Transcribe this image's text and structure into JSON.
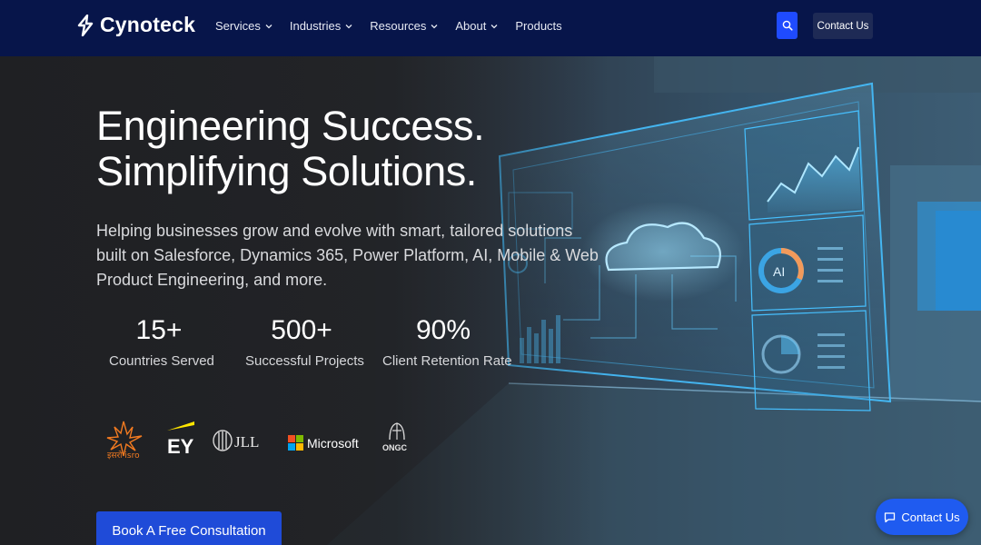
{
  "brand": {
    "name": "Cynoteck"
  },
  "nav": {
    "items": [
      {
        "label": "Services",
        "has_dropdown": true
      },
      {
        "label": "Industries",
        "has_dropdown": true
      },
      {
        "label": "Resources",
        "has_dropdown": true
      },
      {
        "label": "About",
        "has_dropdown": true
      },
      {
        "label": "Products",
        "has_dropdown": false
      }
    ],
    "search_icon": "search-icon",
    "contact_label": "Contact Us"
  },
  "hero": {
    "headline_line1": "Engineering Success.",
    "headline_line2": "Simplifying Solutions.",
    "subtitle": "Helping businesses grow and evolve with smart, tailored solutions built on Salesforce, Dynamics 365, Power Platform, AI, Mobile & Web Product Engineering, and more.",
    "stats": [
      {
        "value": "15+",
        "label": "Countries Served"
      },
      {
        "value": "500+",
        "label": "Successful Projects"
      },
      {
        "value": "90%",
        "label": "Client Retention Rate"
      }
    ],
    "clients": [
      {
        "name": "ISRO",
        "text": "इसरो isro"
      },
      {
        "name": "EY",
        "text": "EY"
      },
      {
        "name": "JLL",
        "text": "JLL"
      },
      {
        "name": "Microsoft",
        "text": "Microsoft"
      },
      {
        "name": "ONGC",
        "text": "ONGC"
      }
    ],
    "cta_label": "Book A Free Consultation",
    "art_ai_label": "AI"
  },
  "floating_contact": {
    "label": "Contact Us",
    "icon": "chat-icon"
  },
  "colors": {
    "nav_bg": "#07154a",
    "accent_blue": "#1f4bd8",
    "glow_cyan": "#39c2ff"
  }
}
